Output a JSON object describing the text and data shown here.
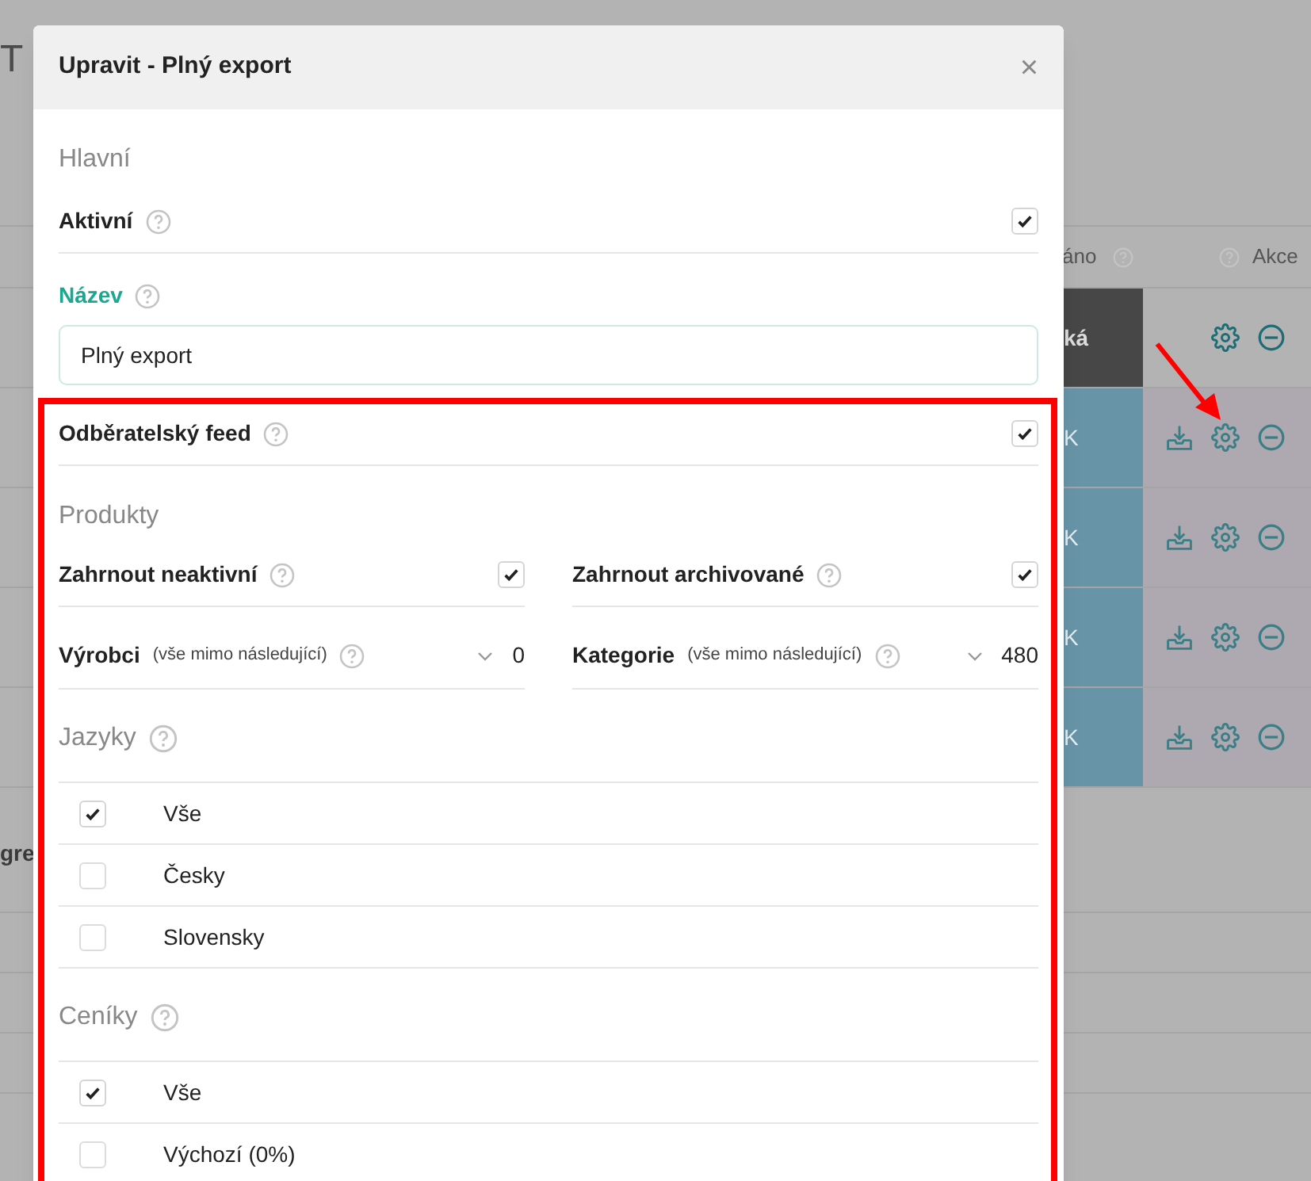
{
  "background": {
    "heading_fragment": "T",
    "side_fragment": "gre",
    "columns": [
      {
        "label": "áno"
      },
      {
        "label": "Akce"
      }
    ],
    "rows": [
      {
        "kind": "dark",
        "cell": "ká",
        "download": false
      },
      {
        "kind": "blue",
        "cell": "K",
        "download": true
      },
      {
        "kind": "blue",
        "cell": "K",
        "download": true
      },
      {
        "kind": "blue",
        "cell": "K",
        "download": true
      },
      {
        "kind": "blue",
        "cell": "K",
        "download": true
      }
    ]
  },
  "dialog": {
    "title": "Upravit - Plný export",
    "close": "×",
    "main_section": {
      "title": "Hlavní",
      "active": {
        "label": "Aktivní",
        "checked": true
      },
      "name_label": "Název",
      "name_value": "Plný export"
    },
    "feed": {
      "label": "Odběratelský feed",
      "checked": true
    },
    "products": {
      "title": "Produkty",
      "checks": [
        {
          "label": "Zahrnout neaktivní",
          "checked": true
        },
        {
          "label": "Zahrnout archivované",
          "checked": true
        }
      ],
      "selects": [
        {
          "label": "Výrobci",
          "hint": "(vše mimo následující)",
          "value": "0"
        },
        {
          "label": "Kategorie",
          "hint": "(vše mimo následující)",
          "value": "480"
        }
      ]
    },
    "lists": [
      {
        "title": "Jazyky",
        "items": [
          {
            "label": "Vše",
            "checked": true
          },
          {
            "label": "Česky",
            "checked": false
          },
          {
            "label": "Slovensky",
            "checked": false
          }
        ]
      },
      {
        "title": "Ceníky",
        "items": [
          {
            "label": "Vše",
            "checked": true
          },
          {
            "label": "Výchozí (0%)",
            "checked": false
          }
        ]
      }
    ]
  }
}
